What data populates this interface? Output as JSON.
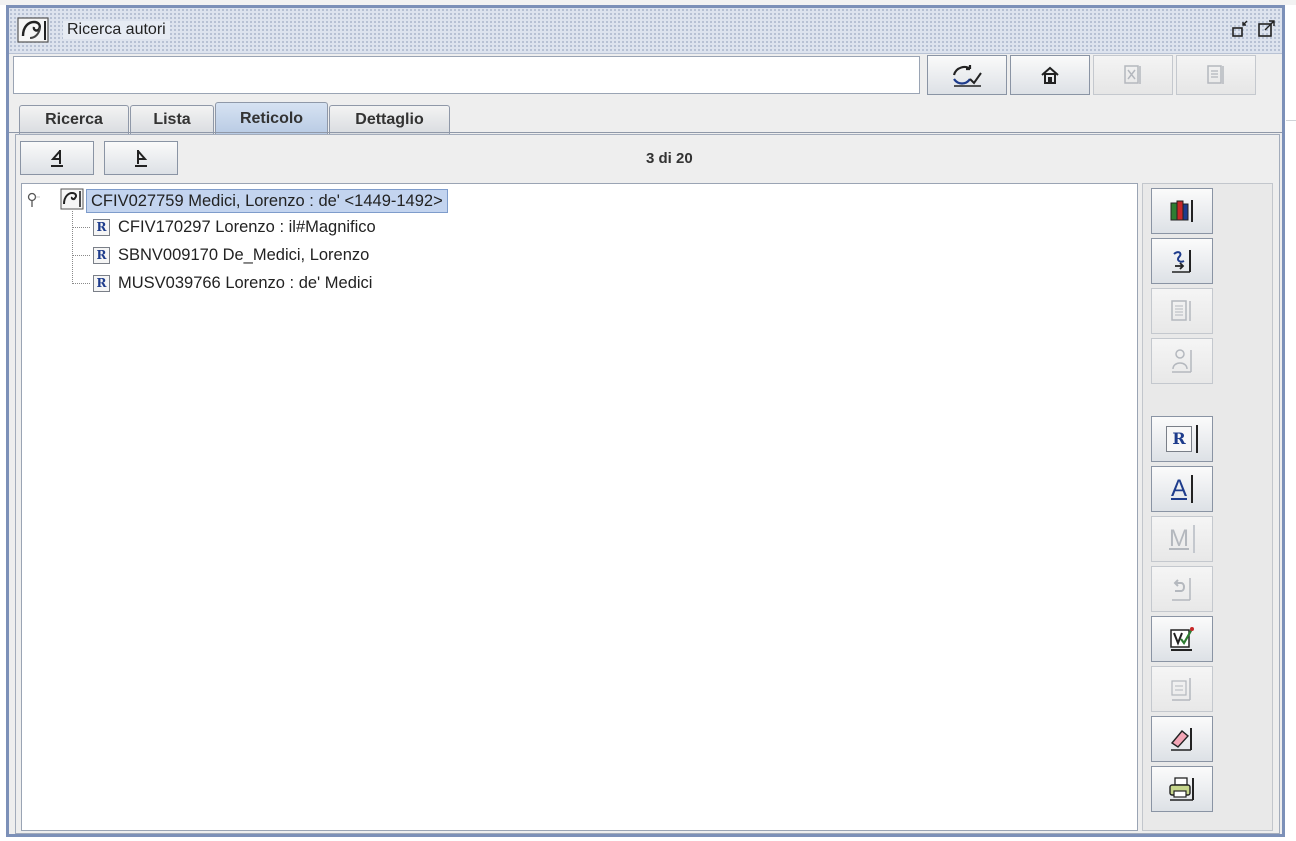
{
  "window": {
    "title": "Ricerca autori",
    "controls": [
      "restore-icon",
      "maximize-icon"
    ]
  },
  "toolbar": {
    "search_value": "",
    "buttons": [
      {
        "name": "confirm-icon",
        "enabled": true
      },
      {
        "name": "home-icon",
        "enabled": true
      },
      {
        "name": "close-doc-icon",
        "enabled": false
      },
      {
        "name": "document-icon",
        "enabled": false
      }
    ]
  },
  "tabs": [
    {
      "label": "Ricerca",
      "active": false
    },
    {
      "label": "Lista",
      "active": false
    },
    {
      "label": "Reticolo",
      "active": true
    },
    {
      "label": "Dettaglio",
      "active": false
    }
  ],
  "nav": {
    "prev_icon": "prev-record-icon",
    "next_icon": "next-record-icon",
    "page_indicator": "3 di 20"
  },
  "tree": {
    "root": {
      "label": "CFIV027759 Medici, Lorenzo : de' <1449-1492>",
      "icon": "author-icon"
    },
    "children": [
      {
        "badge": "R",
        "label": "CFIV170297 Lorenzo : il#Magnifico"
      },
      {
        "badge": "R",
        "label": "SBNV009170 De_Medici, Lorenzo"
      },
      {
        "badge": "R",
        "label": "MUSV039766 Lorenzo : de' Medici"
      }
    ]
  },
  "side_buttons": [
    {
      "name": "books-icon",
      "enabled": true
    },
    {
      "name": "author-link-icon",
      "enabled": true
    },
    {
      "name": "list-icon",
      "enabled": false
    },
    {
      "name": "person-icon",
      "enabled": false
    },
    {
      "name": "rinvio-icon",
      "letter": "R",
      "enabled": true
    },
    {
      "name": "alternative-form-icon",
      "letter": "A",
      "enabled": true
    },
    {
      "name": "merge-icon",
      "letter": "M",
      "enabled": false
    },
    {
      "name": "undo-icon",
      "enabled": false
    },
    {
      "name": "validate-icon",
      "enabled": true
    },
    {
      "name": "note-icon",
      "enabled": false
    },
    {
      "name": "eraser-icon",
      "enabled": true
    },
    {
      "name": "print-icon",
      "enabled": true
    }
  ]
}
